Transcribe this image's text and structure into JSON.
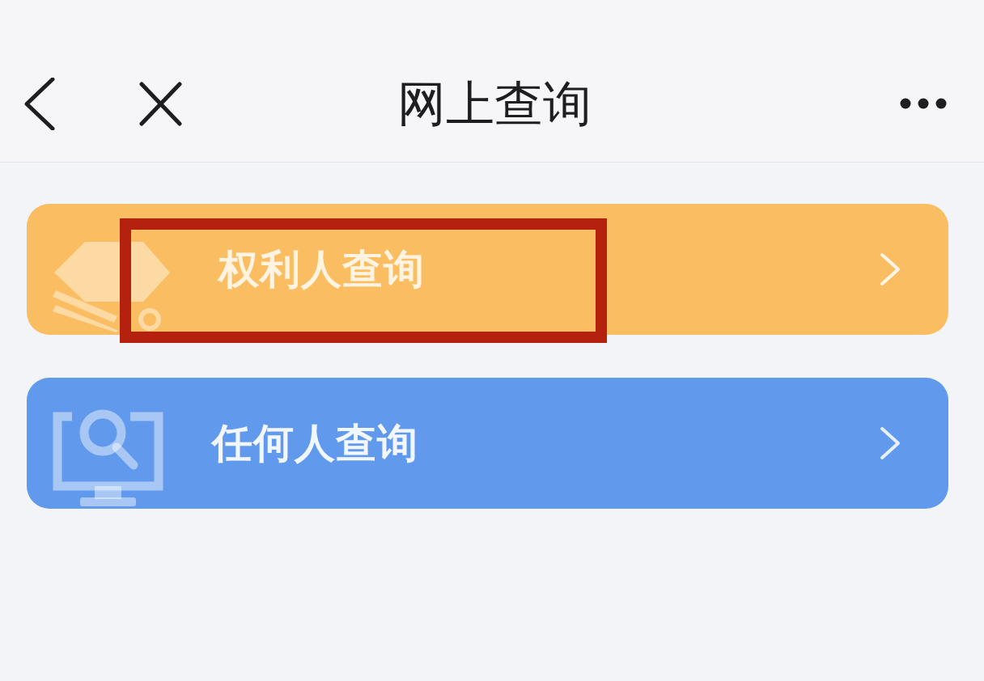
{
  "header": {
    "title": "网上查询"
  },
  "query_options": [
    {
      "kind": "rights_holder",
      "label": "权利人查询",
      "color": "#fbbd62",
      "highlighted": true
    },
    {
      "kind": "anyone",
      "label": "任何人查询",
      "color": "#6199ec",
      "highlighted": false
    }
  ]
}
